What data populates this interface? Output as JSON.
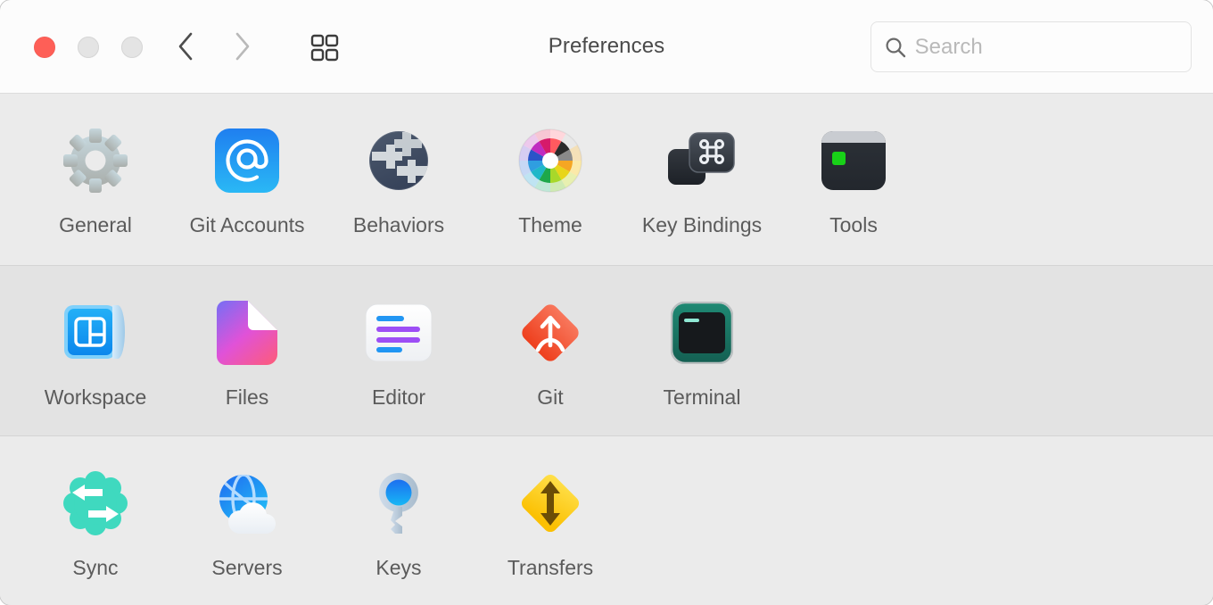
{
  "window": {
    "title": "Preferences",
    "traffic_lights": [
      {
        "name": "close",
        "color": "#fe5f57"
      },
      {
        "name": "minimize",
        "color": "#e4e4e4"
      },
      {
        "name": "zoom",
        "color": "#e4e4e4"
      }
    ],
    "toolbar": {
      "back_icon": "chevron-left-icon",
      "forward_icon": "chevron-right-icon",
      "grid_icon": "show-all-grid-icon"
    },
    "search": {
      "placeholder": "Search",
      "value": "",
      "icon": "search-icon"
    }
  },
  "rows": [
    {
      "items": [
        {
          "label": "General",
          "icon": "gear-icon"
        },
        {
          "label": "Git Accounts",
          "icon": "at-sign-icon"
        },
        {
          "label": "Behaviors",
          "icon": "globe-gears-icon"
        },
        {
          "label": "Theme",
          "icon": "color-wheel-icon"
        },
        {
          "label": "Key Bindings",
          "icon": "keyboard-command-icon"
        },
        {
          "label": "Tools",
          "icon": "tools-terminal-icon"
        }
      ]
    },
    {
      "items": [
        {
          "label": "Workspace",
          "icon": "blueprint-layout-icon"
        },
        {
          "label": "Files",
          "icon": "document-folded-icon"
        },
        {
          "label": "Editor",
          "icon": "text-lines-icon"
        },
        {
          "label": "Git",
          "icon": "git-merge-diamond-icon"
        },
        {
          "label": "Terminal",
          "icon": "terminal-window-icon"
        }
      ]
    },
    {
      "items": [
        {
          "label": "Sync",
          "icon": "sync-arrows-icon"
        },
        {
          "label": "Servers",
          "icon": "globe-cloud-icon"
        },
        {
          "label": "Keys",
          "icon": "key-icon"
        },
        {
          "label": "Transfers",
          "icon": "transfers-diamond-icon"
        }
      ]
    }
  ],
  "colors": {
    "accent_blue": "#1a8cff",
    "git_red": "#f0543c",
    "transfers_yellow": "#ffd11a",
    "sync_teal": "#3fd9bf",
    "terminal_green": "#1e7f6e",
    "row_band_light": "#ebebeb",
    "row_band_dark": "#e3e3e3"
  }
}
